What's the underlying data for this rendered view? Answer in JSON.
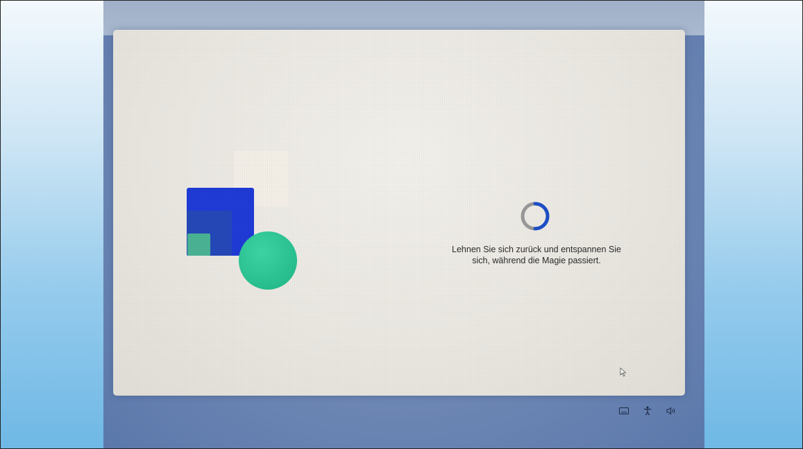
{
  "setup": {
    "message_line1": "Lehnen Sie sich zurück und entspannen Sie",
    "message_line2": "sich, während die Magie passiert.",
    "spinner": "loading-spinner-icon"
  },
  "tray": {
    "icons": [
      "keyboard-icon",
      "accessibility-icon",
      "volume-icon"
    ]
  },
  "colors": {
    "screen_background": "#ebe8e2",
    "accent_blue": "#1f3bd6",
    "accent_green": "#28c08f",
    "spinner_blue": "#1e4fc8"
  }
}
